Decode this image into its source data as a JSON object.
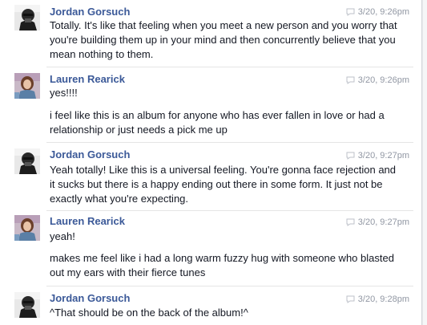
{
  "messages": [
    {
      "sender": "Jordan Gorsuch",
      "time": "3/20, 9:26pm",
      "avatar_icon": "jordan-avatar",
      "paragraphs": [
        "Totally. It's like that feeling when you meet a new person and you worry that you're building them up in your mind and then concurrently believe that you mean nothing to them."
      ]
    },
    {
      "sender": "Lauren Rearick",
      "time": "3/20, 9:26pm",
      "avatar_icon": "lauren-avatar",
      "paragraphs": [
        "yes!!!!",
        "i feel like this is an album for anyone who has ever fallen in love or had a relationship or just needs a pick me up"
      ]
    },
    {
      "sender": "Jordan Gorsuch",
      "time": "3/20, 9:27pm",
      "avatar_icon": "jordan-avatar",
      "paragraphs": [
        "Yeah totally! Like this is a universal feeling. You're gonna face rejection and it sucks but there is a happy ending out there in some form. It just not be exactly what you're expecting."
      ]
    },
    {
      "sender": "Lauren Rearick",
      "time": "3/20, 9:27pm",
      "avatar_icon": "lauren-avatar",
      "paragraphs": [
        "yeah!",
        "makes me feel like i had a long warm fuzzy hug with someone who blasted out my ears with their fierce tunes"
      ]
    },
    {
      "sender": "Jordan Gorsuch",
      "time": "3/20, 9:28pm",
      "avatar_icon": "jordan-avatar",
      "paragraphs": [
        "^That should be on the back of the album!^"
      ]
    }
  ],
  "colors": {
    "name": "#3b5998",
    "text": "#141823",
    "timestamp": "#9197a3",
    "divider": "#e5e5e5"
  }
}
